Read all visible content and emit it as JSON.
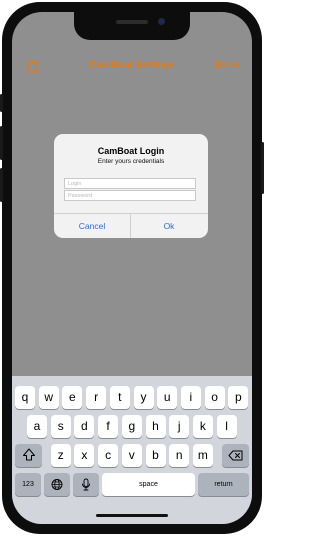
{
  "nav": {
    "title": "CamBoat Settings",
    "done_label": "Done",
    "refresh_icon": "refresh-icon"
  },
  "dialog": {
    "title": "CamBoat Login",
    "message": "Enter yours credentials",
    "login_placeholder": "Login",
    "password_placeholder": "Password",
    "cancel_label": "Cancel",
    "ok_label": "Ok"
  },
  "keyboard": {
    "row1": [
      "q",
      "w",
      "e",
      "r",
      "t",
      "y",
      "u",
      "i",
      "o",
      "p"
    ],
    "row2": [
      "a",
      "s",
      "d",
      "f",
      "g",
      "h",
      "j",
      "k",
      "l"
    ],
    "row3": [
      "z",
      "x",
      "c",
      "v",
      "b",
      "n",
      "m"
    ],
    "numbers_label": "123",
    "space_label": "space",
    "return_label": "return",
    "shift_icon": "shift-icon",
    "backspace_icon": "backspace-icon",
    "globe_icon": "globe-icon",
    "mic_icon": "microphone-icon"
  },
  "colors": {
    "accent": "#e67a12",
    "dialog_button": "#2a6ed8"
  }
}
